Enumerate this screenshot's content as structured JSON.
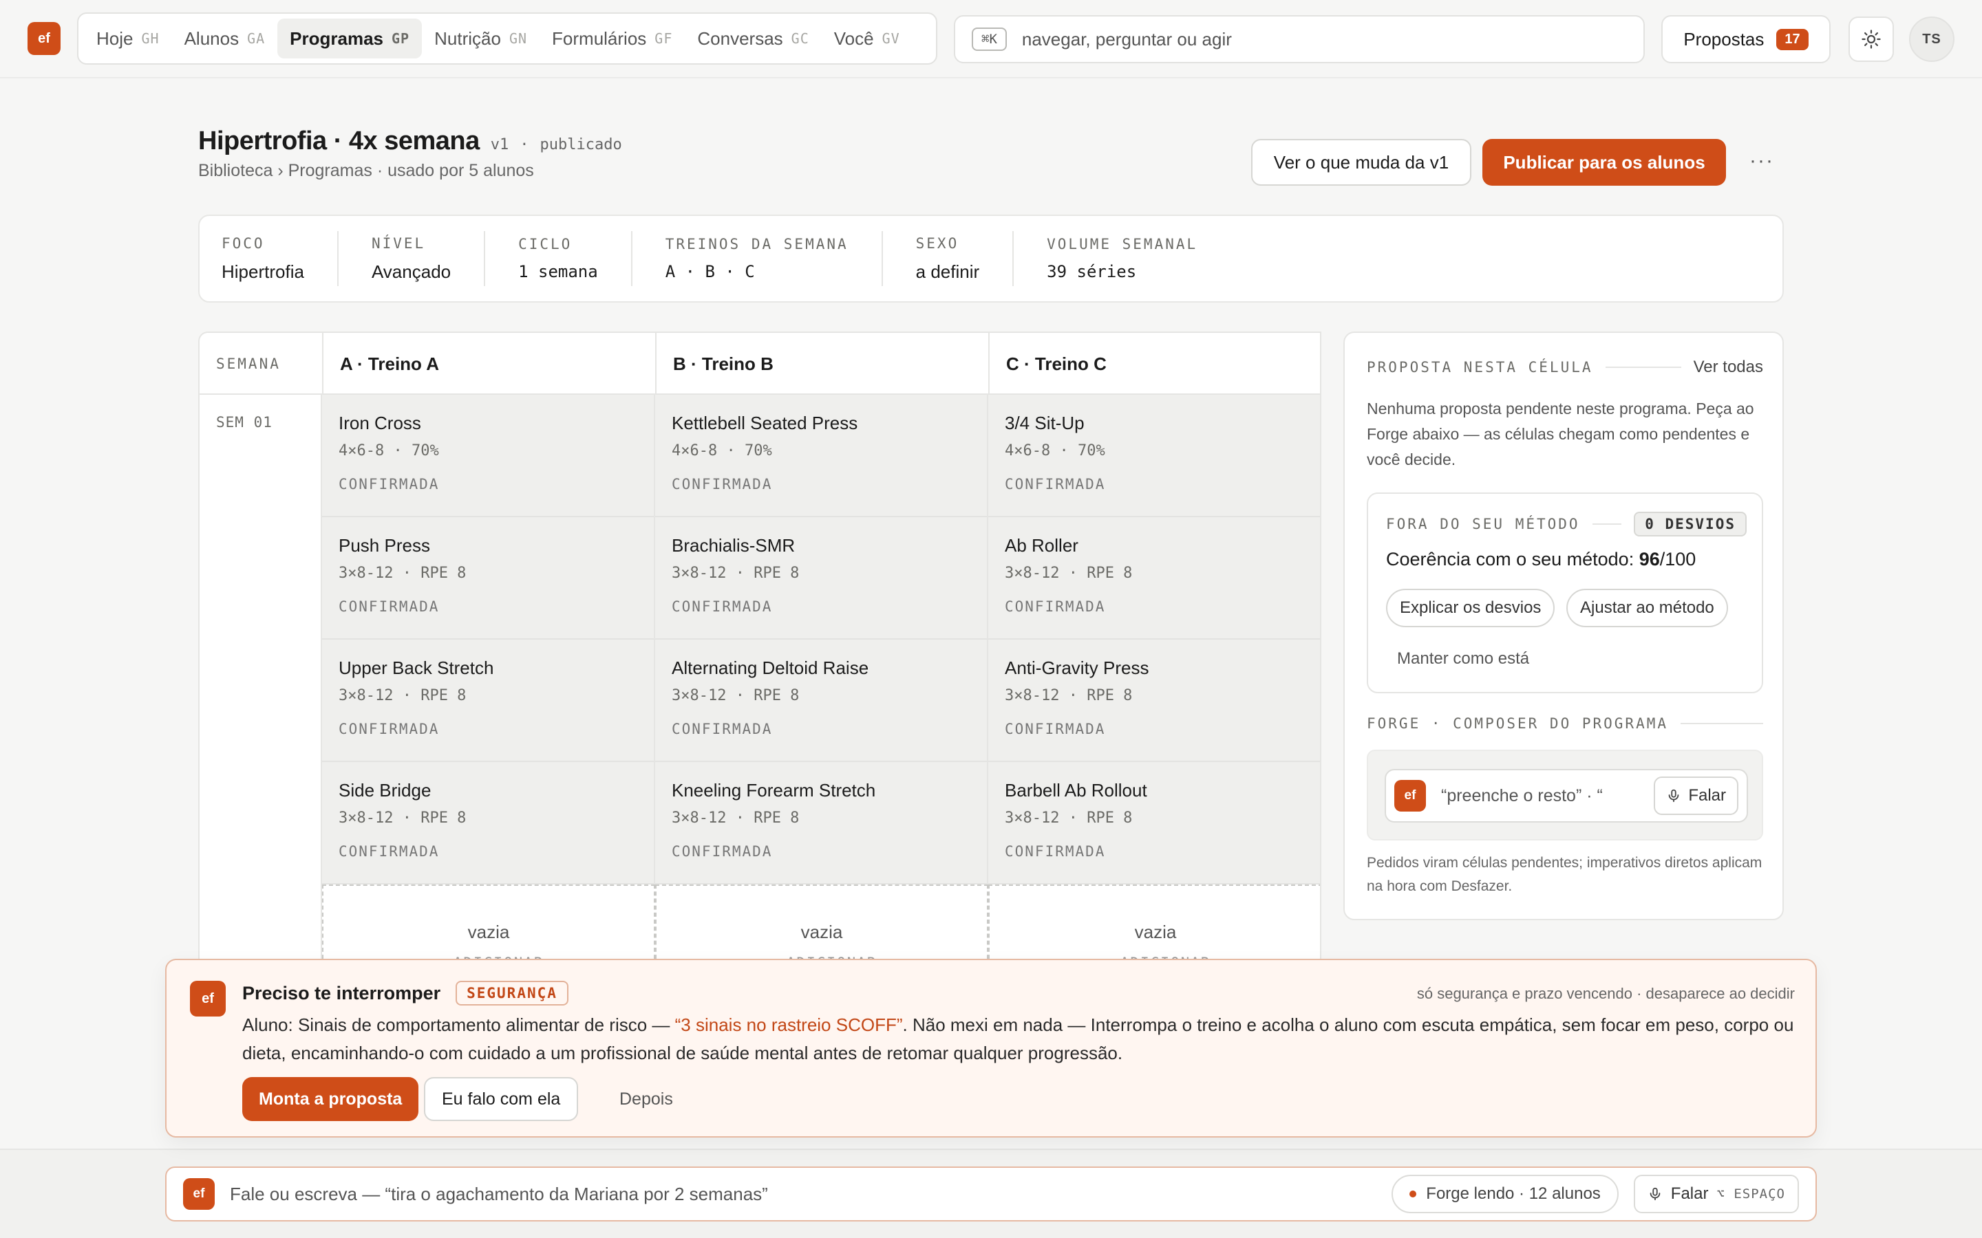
{
  "brand": {
    "logo_text": "ef",
    "accent": "#cf4d18"
  },
  "nav": {
    "items": [
      {
        "label": "Hoje",
        "key": "GH",
        "active": false
      },
      {
        "label": "Alunos",
        "key": "GA",
        "active": false
      },
      {
        "label": "Programas",
        "key": "GP",
        "active": true
      },
      {
        "label": "Nutrição",
        "key": "GN",
        "active": false
      },
      {
        "label": "Formulários",
        "key": "GF",
        "active": false
      },
      {
        "label": "Conversas",
        "key": "GC",
        "active": false
      },
      {
        "label": "Você",
        "key": "GV",
        "active": false
      }
    ]
  },
  "command": {
    "shortcut": "⌘K",
    "placeholder": "navegar, perguntar ou agir"
  },
  "proposals": {
    "label": "Propostas",
    "count": "17"
  },
  "theme": {
    "icon": "sun-icon"
  },
  "user": {
    "initials": "TS"
  },
  "program": {
    "title": "Hipertrofia · 4x semana",
    "version": "v1",
    "sep": "·",
    "status": "publicado",
    "breadcrumb": "Biblioteca › Programas · usado por 5 alunos",
    "diff_label": "Ver o que muda da v1",
    "publish_label": "Publicar para os alunos",
    "more": "···"
  },
  "meta": [
    {
      "label": "FOCO",
      "value": "Hipertrofia",
      "mono": false
    },
    {
      "label": "NÍVEL",
      "value": "Avançado",
      "mono": false
    },
    {
      "label": "CICLO",
      "value": "1 semana",
      "mono": true
    },
    {
      "label": "TREINOS DA SEMANA",
      "value": "A · B · C",
      "mono": true
    },
    {
      "label": "SEXO",
      "value": "a definir",
      "mono": false
    },
    {
      "label": "VOLUME SEMANAL",
      "value": "39 séries",
      "mono": true
    }
  ],
  "grid": {
    "week_header": "SEMANA",
    "week_label": "SEM 01",
    "columns": [
      "A · Treino A",
      "B · Treino B",
      "C · Treino C"
    ],
    "rows": [
      [
        {
          "name": "Iron Cross",
          "spec": "4×6-8 · 70%",
          "status": "CONFIRMADA"
        },
        {
          "name": "Kettlebell Seated Press",
          "spec": "4×6-8 · 70%",
          "status": "CONFIRMADA"
        },
        {
          "name": "3/4 Sit-Up",
          "spec": "4×6-8 · 70%",
          "status": "CONFIRMADA"
        }
      ],
      [
        {
          "name": "Push Press",
          "spec": "3×8-12 · RPE 8",
          "status": "CONFIRMADA"
        },
        {
          "name": "Brachialis-SMR",
          "spec": "3×8-12 · RPE 8",
          "status": "CONFIRMADA"
        },
        {
          "name": "Ab Roller",
          "spec": "3×8-12 · RPE 8",
          "status": "CONFIRMADA"
        }
      ],
      [
        {
          "name": "Upper Back Stretch",
          "spec": "3×8-12 · RPE 8",
          "status": "CONFIRMADA"
        },
        {
          "name": "Alternating Deltoid Raise",
          "spec": "3×8-12 · RPE 8",
          "status": "CONFIRMADA"
        },
        {
          "name": "Anti-Gravity Press",
          "spec": "3×8-12 · RPE 8",
          "status": "CONFIRMADA"
        }
      ],
      [
        {
          "name": "Side Bridge",
          "spec": "3×8-12 · RPE 8",
          "status": "CONFIRMADA"
        },
        {
          "name": "Kneeling Forearm Stretch",
          "spec": "3×8-12 · RPE 8",
          "status": "CONFIRMADA"
        },
        {
          "name": "Barbell Ab Rollout",
          "spec": "3×8-12 · RPE 8",
          "status": "CONFIRMADA"
        }
      ]
    ],
    "empty_label": "vazia",
    "empty_sub": "+ ADICIONAR"
  },
  "side": {
    "title": "PROPOSTA NESTA CÉLULA",
    "see_all": "Ver todas",
    "description": "Nenhuma proposta pendente neste programa. Peça ao Forge abaixo — as células chegam como pendentes e você decide.",
    "method": {
      "title": "FORA DO SEU MÉTODO",
      "badge": "0 DESVIOS",
      "coherence_prefix": "Coerência com o seu método: ",
      "score": "96",
      "score_total": "/100",
      "explain": "Explicar os desvios",
      "adjust": "Ajustar ao método",
      "keep": "Manter como está"
    },
    "composer": {
      "title": "FORGE · COMPOSER DO PROGRAMA",
      "placeholder": "“preenche o resto” · “",
      "speak": "Falar"
    },
    "footnote": "Pedidos viram células pendentes; imperativos diretos aplicam na hora com Desfazer."
  },
  "banner": {
    "title": "Preciso te interromper",
    "tag": "SEGURANÇA",
    "note": "só segurança e prazo vencendo · desaparece ao decidir",
    "text_before": "Aluno: Sinais de comportamento alimentar de risco — ",
    "text_highlight": "“3 sinais no rastreio SCOFF”",
    "text_after": ". Não mexi em nada — Interrompa o treino e acolha o aluno com escuta empática, sem focar em peso, corpo ou dieta, encaminhando-o com cuidado a um profissional de saúde mental antes de retomar qualquer progressão.",
    "primary": "Monta a proposta",
    "secondary": "Eu falo com ela",
    "ghost": "Depois"
  },
  "bottom": {
    "placeholder": "Fale ou escreva — “tira o agachamento da Mariana por 2 semanas”",
    "reading": "Forge lendo · 12 alunos",
    "speak": "Falar",
    "shortcut": "⌥ ESPAÇO"
  }
}
